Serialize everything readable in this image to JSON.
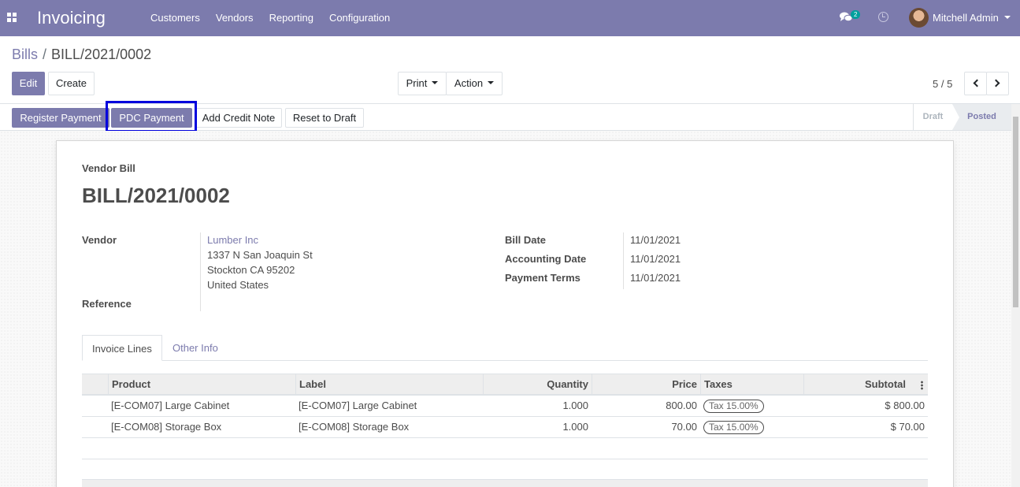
{
  "navbar": {
    "app_title": "Invoicing",
    "menu": [
      "Customers",
      "Vendors",
      "Reporting",
      "Configuration"
    ],
    "chat_count": "2",
    "user_name": "Mitchell Admin",
    "bg_color": "#7c7bad"
  },
  "breadcrumb": {
    "parent": "Bills",
    "separator": "/",
    "current": "BILL/2021/0002"
  },
  "toolbar": {
    "edit_label": "Edit",
    "create_label": "Create",
    "print_label": "Print",
    "action_label": "Action",
    "pager_value": "5 / 5"
  },
  "statusbar": {
    "register_payment_label": "Register Payment",
    "pdc_payment_label": "PDC Payment",
    "add_credit_note_label": "Add Credit Note",
    "reset_to_draft_label": "Reset to Draft",
    "stages": [
      "Draft",
      "Posted"
    ],
    "active_stage": "Posted"
  },
  "document": {
    "type_label": "Vendor Bill",
    "name": "BILL/2021/0002",
    "vendor_label": "Vendor",
    "vendor_name": "Lumber Inc",
    "vendor_address": [
      "1337 N San Joaquin St",
      "Stockton CA 95202",
      "United States"
    ],
    "reference_label": "Reference",
    "bill_date_label": "Bill Date",
    "bill_date": "11/01/2021",
    "accounting_date_label": "Accounting Date",
    "accounting_date": "11/01/2021",
    "payment_terms_label": "Payment Terms",
    "payment_terms": "11/01/2021"
  },
  "tabs": {
    "invoice_lines": "Invoice Lines",
    "other_info": "Other Info"
  },
  "lines_table": {
    "headers": {
      "product": "Product",
      "label": "Label",
      "quantity": "Quantity",
      "price": "Price",
      "taxes": "Taxes",
      "subtotal": "Subtotal"
    },
    "rows": [
      {
        "product": "[E-COM07] Large Cabinet",
        "label": "[E-COM07] Large Cabinet",
        "quantity": "1.000",
        "price": "800.00",
        "tax": "Tax 15.00%",
        "subtotal": "$ 800.00"
      },
      {
        "product": "[E-COM08] Storage Box",
        "label": "[E-COM08] Storage Box",
        "quantity": "1.000",
        "price": "70.00",
        "tax": "Tax 15.00%",
        "subtotal": "$ 70.00"
      }
    ]
  }
}
